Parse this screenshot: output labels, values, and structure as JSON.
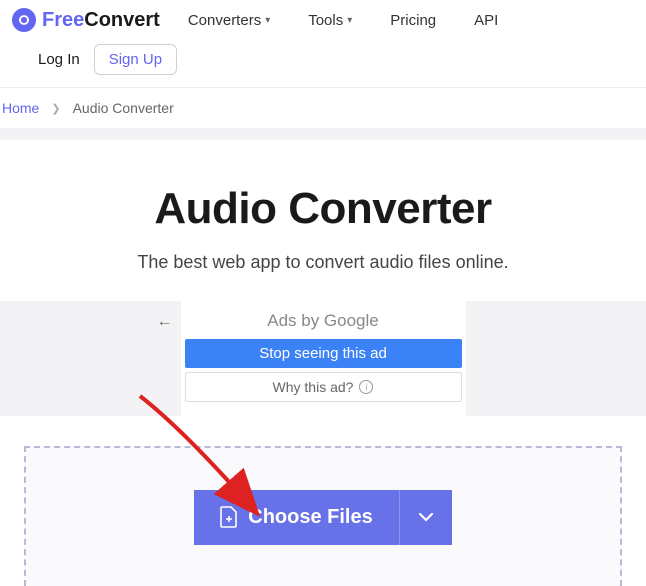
{
  "brand": {
    "free": "Free",
    "convert": "Convert"
  },
  "nav": {
    "converters": "Converters",
    "tools": "Tools",
    "pricing": "Pricing",
    "api": "API"
  },
  "auth": {
    "login": "Log In",
    "signup": "Sign Up"
  },
  "breadcrumb": {
    "home": "Home",
    "current": "Audio Converter"
  },
  "hero": {
    "title": "Audio Converter",
    "subtitle": "The best web app to convert audio files online."
  },
  "ad": {
    "header": "Ads by Google",
    "stop": "Stop seeing this ad",
    "why": "Why this ad?"
  },
  "upload": {
    "choose": "Choose Files"
  }
}
